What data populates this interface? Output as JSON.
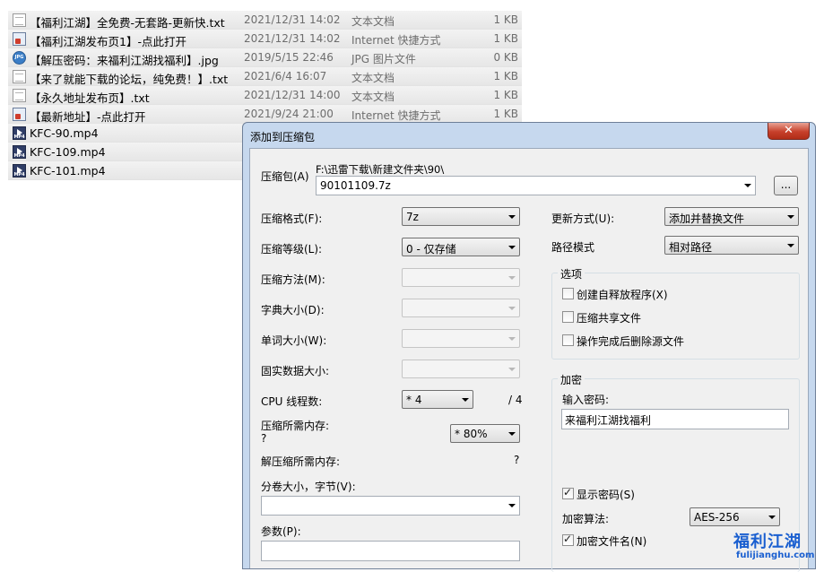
{
  "files": [
    {
      "name": "【福利江湖】全免费-无套路-更新快.txt",
      "date": "2021/12/31 14:02",
      "type": "文本文档",
      "size": "1 KB",
      "icon": "text-file-icon"
    },
    {
      "name": "【福利江湖发布页1】-点此打开",
      "date": "2021/12/31 14:02",
      "type": "Internet 快捷方式",
      "size": "1 KB",
      "icon": "shortcut-icon"
    },
    {
      "name": "【解压密码：来福利江湖找福利】.jpg",
      "date": "2019/5/15 22:46",
      "type": "JPG 图片文件",
      "size": "0 KB",
      "icon": "jpg-file-icon"
    },
    {
      "name": "【来了就能下载的论坛，纯免费！】.txt",
      "date": "2021/6/4 16:07",
      "type": "文本文档",
      "size": "1 KB",
      "icon": "text-file-icon"
    },
    {
      "name": "【永久地址发布页】.txt",
      "date": "2021/12/31 14:00",
      "type": "文本文档",
      "size": "1 KB",
      "icon": "text-file-icon"
    },
    {
      "name": "【最新地址】-点此打开",
      "date": "2021/9/24 21:00",
      "type": "Internet 快捷方式",
      "size": "1 KB",
      "icon": "shortcut-icon"
    },
    {
      "name": "KFC-90.mp4",
      "date": "",
      "type": "",
      "size": "",
      "icon": "mp4-file-icon"
    },
    {
      "name": "KFC-109.mp4",
      "date": "",
      "type": "",
      "size": "",
      "icon": "mp4-file-icon"
    },
    {
      "name": "KFC-101.mp4",
      "date": "",
      "type": "",
      "size": "",
      "icon": "mp4-file-icon"
    }
  ],
  "dialog": {
    "title": "添加到压缩包",
    "close": "✕",
    "archive_label": "压缩包(A)",
    "archive_path": "F:\\迅雷下载\\新建文件夹\\90\\",
    "archive_name": "90101109.7z",
    "browse": "...",
    "left": [
      {
        "label": "压缩格式(F):",
        "value": "7z",
        "enabled": true
      },
      {
        "label": "压缩等级(L):",
        "value": "0 - 仅存储",
        "enabled": true
      },
      {
        "label": "压缩方法(M):",
        "value": "",
        "enabled": false
      },
      {
        "label": "字典大小(D):",
        "value": "",
        "enabled": false
      },
      {
        "label": "单词大小(W):",
        "value": "",
        "enabled": false
      },
      {
        "label": "固实数据大小:",
        "value": "",
        "enabled": false
      }
    ],
    "cpu_label": "CPU 线程数:",
    "cpu_value": "* 4",
    "cpu_max": "/ 4",
    "mem_label": "压缩所需内存:",
    "mem_value": "?",
    "mem_percent": "* 80%",
    "dmem_label": "解压缩所需内存:",
    "dmem_value": "?",
    "volume_label": "分卷大小，字节(V):",
    "volume_value": "",
    "params_label": "参数(P):",
    "params_value": "",
    "update_label": "更新方式(U):",
    "update_value": "添加并替换文件",
    "path_label": "路径模式",
    "path_value": "相对路径",
    "options_title": "选项",
    "options": [
      {
        "label": "创建自释放程序(X)",
        "checked": false
      },
      {
        "label": "压缩共享文件",
        "checked": false
      },
      {
        "label": "操作完成后删除源文件",
        "checked": false
      }
    ],
    "encrypt_title": "加密",
    "password_label": "输入密码:",
    "password_value": "来福利江湖找福利",
    "show_password": {
      "label": "显示密码(S)",
      "checked": true
    },
    "algo_label": "加密算法:",
    "algo_value": "AES-256",
    "encrypt_names": {
      "label": "加密文件名(N)",
      "checked": true
    }
  },
  "watermark": {
    "line1": "福利江湖",
    "line2": "fulijianghu.com"
  }
}
